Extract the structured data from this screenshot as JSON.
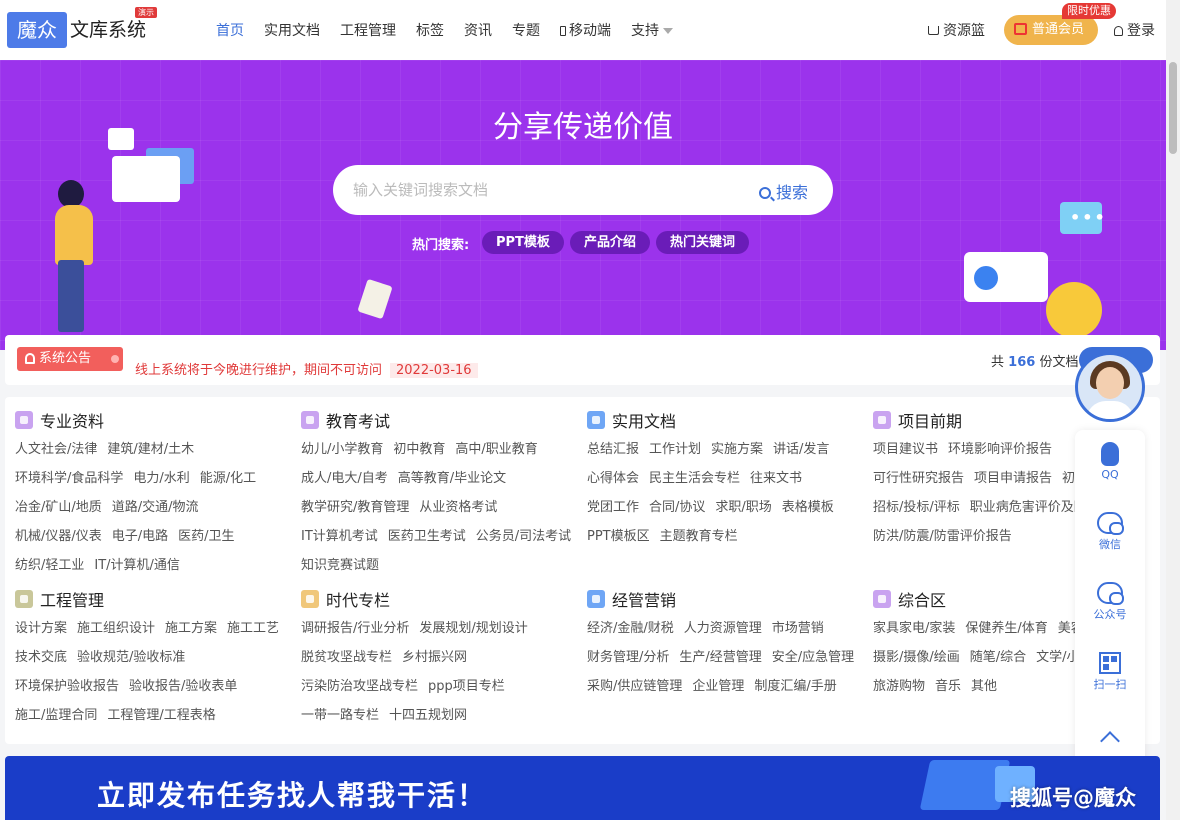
{
  "header": {
    "logo_box": "魔众",
    "logo_text": "文库系统",
    "logo_badge": "演示",
    "nav": [
      {
        "label": "首页",
        "active": true
      },
      {
        "label": "实用文档"
      },
      {
        "label": "工程管理"
      },
      {
        "label": "标签"
      },
      {
        "label": "资讯"
      },
      {
        "label": "专题"
      },
      {
        "label": "移动端",
        "icon": "mobile-icon"
      },
      {
        "label": "支持",
        "icon": "caret-down-icon"
      }
    ],
    "basket": "资源篮",
    "vip_button": "普通会员",
    "vip_tag": "限时优惠",
    "login": "登录"
  },
  "hero": {
    "title": "分享传递价值",
    "search_placeholder": "输入关键词搜索文档",
    "search_button": "搜索",
    "hot_label": "热门搜索:",
    "hot_tags": [
      "PPT模板",
      "产品介绍",
      "热门关键词"
    ]
  },
  "notice": {
    "badge": "系统公告",
    "text": "线上系统将于今晚进行维护，期间不可访问",
    "date": "2022-03-16",
    "count_prefix": "共",
    "count": "166",
    "count_suffix": "份文档"
  },
  "categories": [
    {
      "title": "专业资料",
      "color": "#c9a3f0",
      "rows": [
        [
          "人文社会/法律",
          "建筑/建材/土木"
        ],
        [
          "环境科学/食品科学",
          "电力/水利",
          "能源/化工"
        ],
        [
          "冶金/矿山/地质",
          "道路/交通/物流"
        ],
        [
          "机械/仪器/仪表",
          "电子/电路",
          "医药/卫生"
        ],
        [
          "纺织/轻工业",
          "IT/计算机/通信"
        ]
      ]
    },
    {
      "title": "教育考试",
      "color": "#c9a3f0",
      "rows": [
        [
          "幼儿/小学教育",
          "初中教育",
          "高中/职业教育"
        ],
        [
          "成人/电大/自考",
          "高等教育/毕业论文"
        ],
        [
          "教学研究/教育管理",
          "从业资格考试"
        ],
        [
          "IT计算机考试",
          "医药卫生考试",
          "公务员/司法考试"
        ],
        [
          "知识竞赛试题"
        ]
      ]
    },
    {
      "title": "实用文档",
      "color": "#6fa6f5",
      "rows": [
        [
          "总结汇报",
          "工作计划",
          "实施方案",
          "讲话/发言"
        ],
        [
          "心得体会",
          "民主生活会专栏",
          "往来文书"
        ],
        [
          "党团工作",
          "合同/协议",
          "求职/职场",
          "表格模板"
        ],
        [
          "PPT模板区",
          "主题教育专栏"
        ]
      ]
    },
    {
      "title": "项目前期",
      "color": "#c9a3f0",
      "rows": [
        [
          "项目建议书",
          "环境影响评价报告"
        ],
        [
          "可行性研究报告",
          "项目申请报告",
          "初步设计"
        ],
        [
          "招标/投标/评标",
          "职业病危害评价及防护"
        ],
        [
          "防洪/防震/防雷评价报告"
        ]
      ]
    },
    {
      "title": "工程管理",
      "color": "#c9c79a",
      "rows": [
        [
          "设计方案",
          "施工组织设计",
          "施工方案",
          "施工工艺"
        ],
        [
          "技术交底",
          "验收规范/验收标准"
        ],
        [
          "环境保护验收报告",
          "验收报告/验收表单"
        ],
        [
          "施工/监理合同",
          "工程管理/工程表格"
        ]
      ]
    },
    {
      "title": "时代专栏",
      "color": "#f0c77a",
      "rows": [
        [
          "调研报告/行业分析",
          "发展规划/规划设计"
        ],
        [
          "脱贫攻坚战专栏",
          "乡村振兴网"
        ],
        [
          "污染防治攻坚战专栏",
          "ppp项目专栏"
        ],
        [
          "一带一路专栏",
          "十四五规划网"
        ]
      ]
    },
    {
      "title": "经管营销",
      "color": "#6fa6f5",
      "rows": [
        [
          "经济/金融/财税",
          "人力资源管理",
          "市场营销"
        ],
        [
          "财务管理/分析",
          "生产/经营管理",
          "安全/应急管理"
        ],
        [
          "采购/供应链管理",
          "企业管理",
          "制度汇编/手册"
        ]
      ]
    },
    {
      "title": "综合区",
      "color": "#c9a3f0",
      "rows": [
        [
          "家具家电/家装",
          "保健养生/体育",
          "美容/时尚"
        ],
        [
          "摄影/摄像/绘画",
          "随笔/综合",
          "文学/小说"
        ],
        [
          "旅游购物",
          "音乐",
          "其他"
        ]
      ]
    }
  ],
  "float_bar": {
    "items": [
      {
        "label": "QQ",
        "icon": "qq-icon"
      },
      {
        "label": "微信",
        "icon": "wechat-icon"
      },
      {
        "label": "公众号",
        "icon": "official-account-icon"
      },
      {
        "label": "扫一扫",
        "icon": "qrcode-icon"
      }
    ],
    "top_icon": "arrow-up-icon"
  },
  "banner": {
    "text": "立即发布任务找人帮我干活！"
  },
  "watermark": "搜狐号@魔众"
}
